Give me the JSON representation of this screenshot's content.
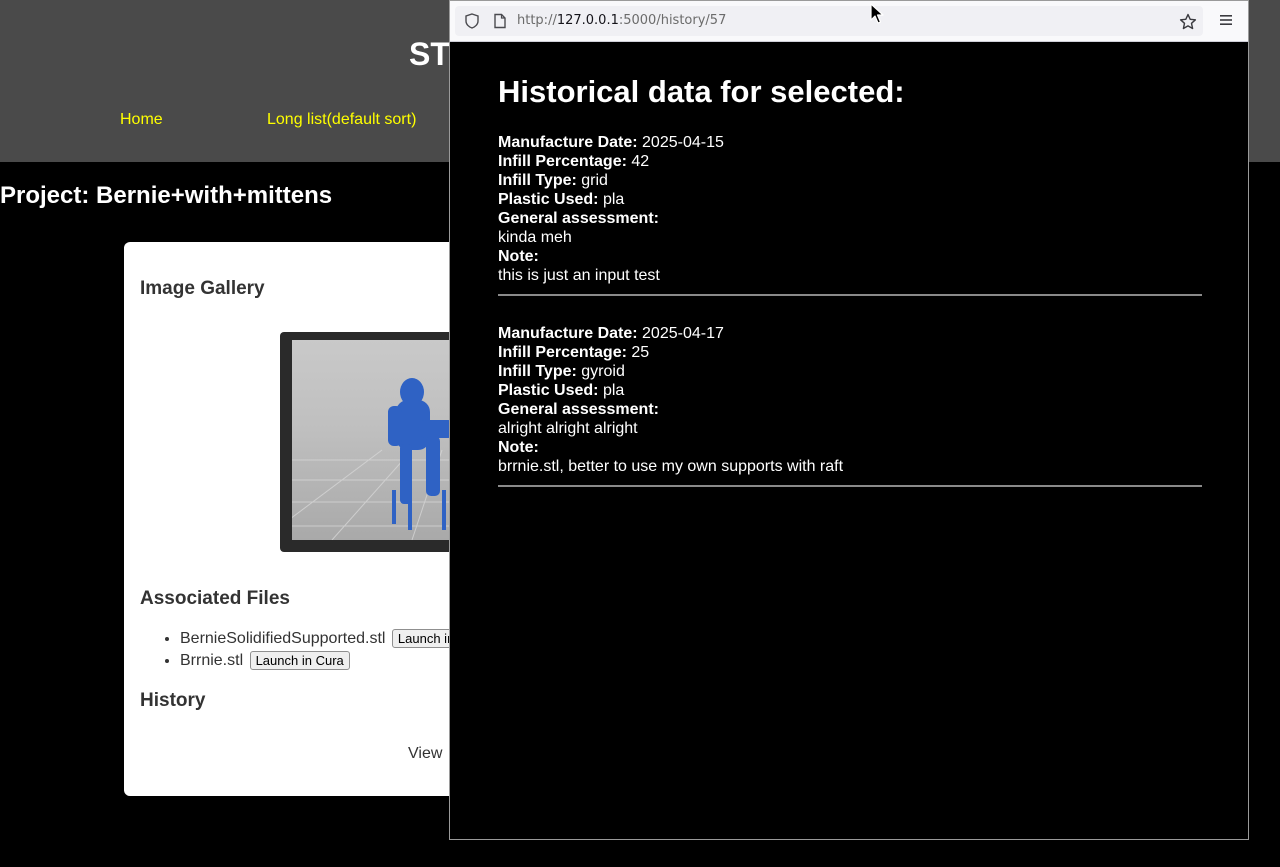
{
  "site": {
    "title_partial": "ST",
    "nav": [
      "Home",
      "Long list(default sort)"
    ]
  },
  "project": {
    "title": "Project: Bernie+with+mittens",
    "gallery_heading": "Image Gallery",
    "files_heading": "Associated Files",
    "files": [
      {
        "name": "BernieSolidifiedSupported.stl",
        "button": "Launch in Cura"
      },
      {
        "name": "Brrnie.stl",
        "button": "Launch in Cura"
      }
    ],
    "history_heading": "History",
    "view_link_partial": "View"
  },
  "popup": {
    "url_prefix": "http://",
    "url_host": "127.0.0.1",
    "url_path": ":5000/history/57",
    "icons": [
      "shield-icon",
      "page-icon",
      "star-icon",
      "hamburger-menu-icon"
    ],
    "heading": "Historical data for selected:",
    "labels": {
      "date": "Manufacture Date:",
      "infill_pct": "Infill Percentage:",
      "infill_type": "Infill Type:",
      "plastic": "Plastic Used:",
      "assessment": "General assessment:",
      "note": "Note:"
    },
    "records": [
      {
        "date": "2025-04-15",
        "infill_pct": "42",
        "infill_type": "grid",
        "plastic": "pla",
        "assessment": "kinda meh",
        "note": "this is just an input test"
      },
      {
        "date": "2025-04-17",
        "infill_pct": "25",
        "infill_type": "gyroid",
        "plastic": "pla",
        "assessment": "alright alright alright",
        "note": "brrnie.stl, better to use my own supports with raft"
      }
    ]
  },
  "colors": {
    "header_bg": "#4a4a4a",
    "nav_link": "#ffff00",
    "page_bg": "#000000",
    "card_bg": "#ffffff",
    "model_blue": "#2f62c4"
  }
}
